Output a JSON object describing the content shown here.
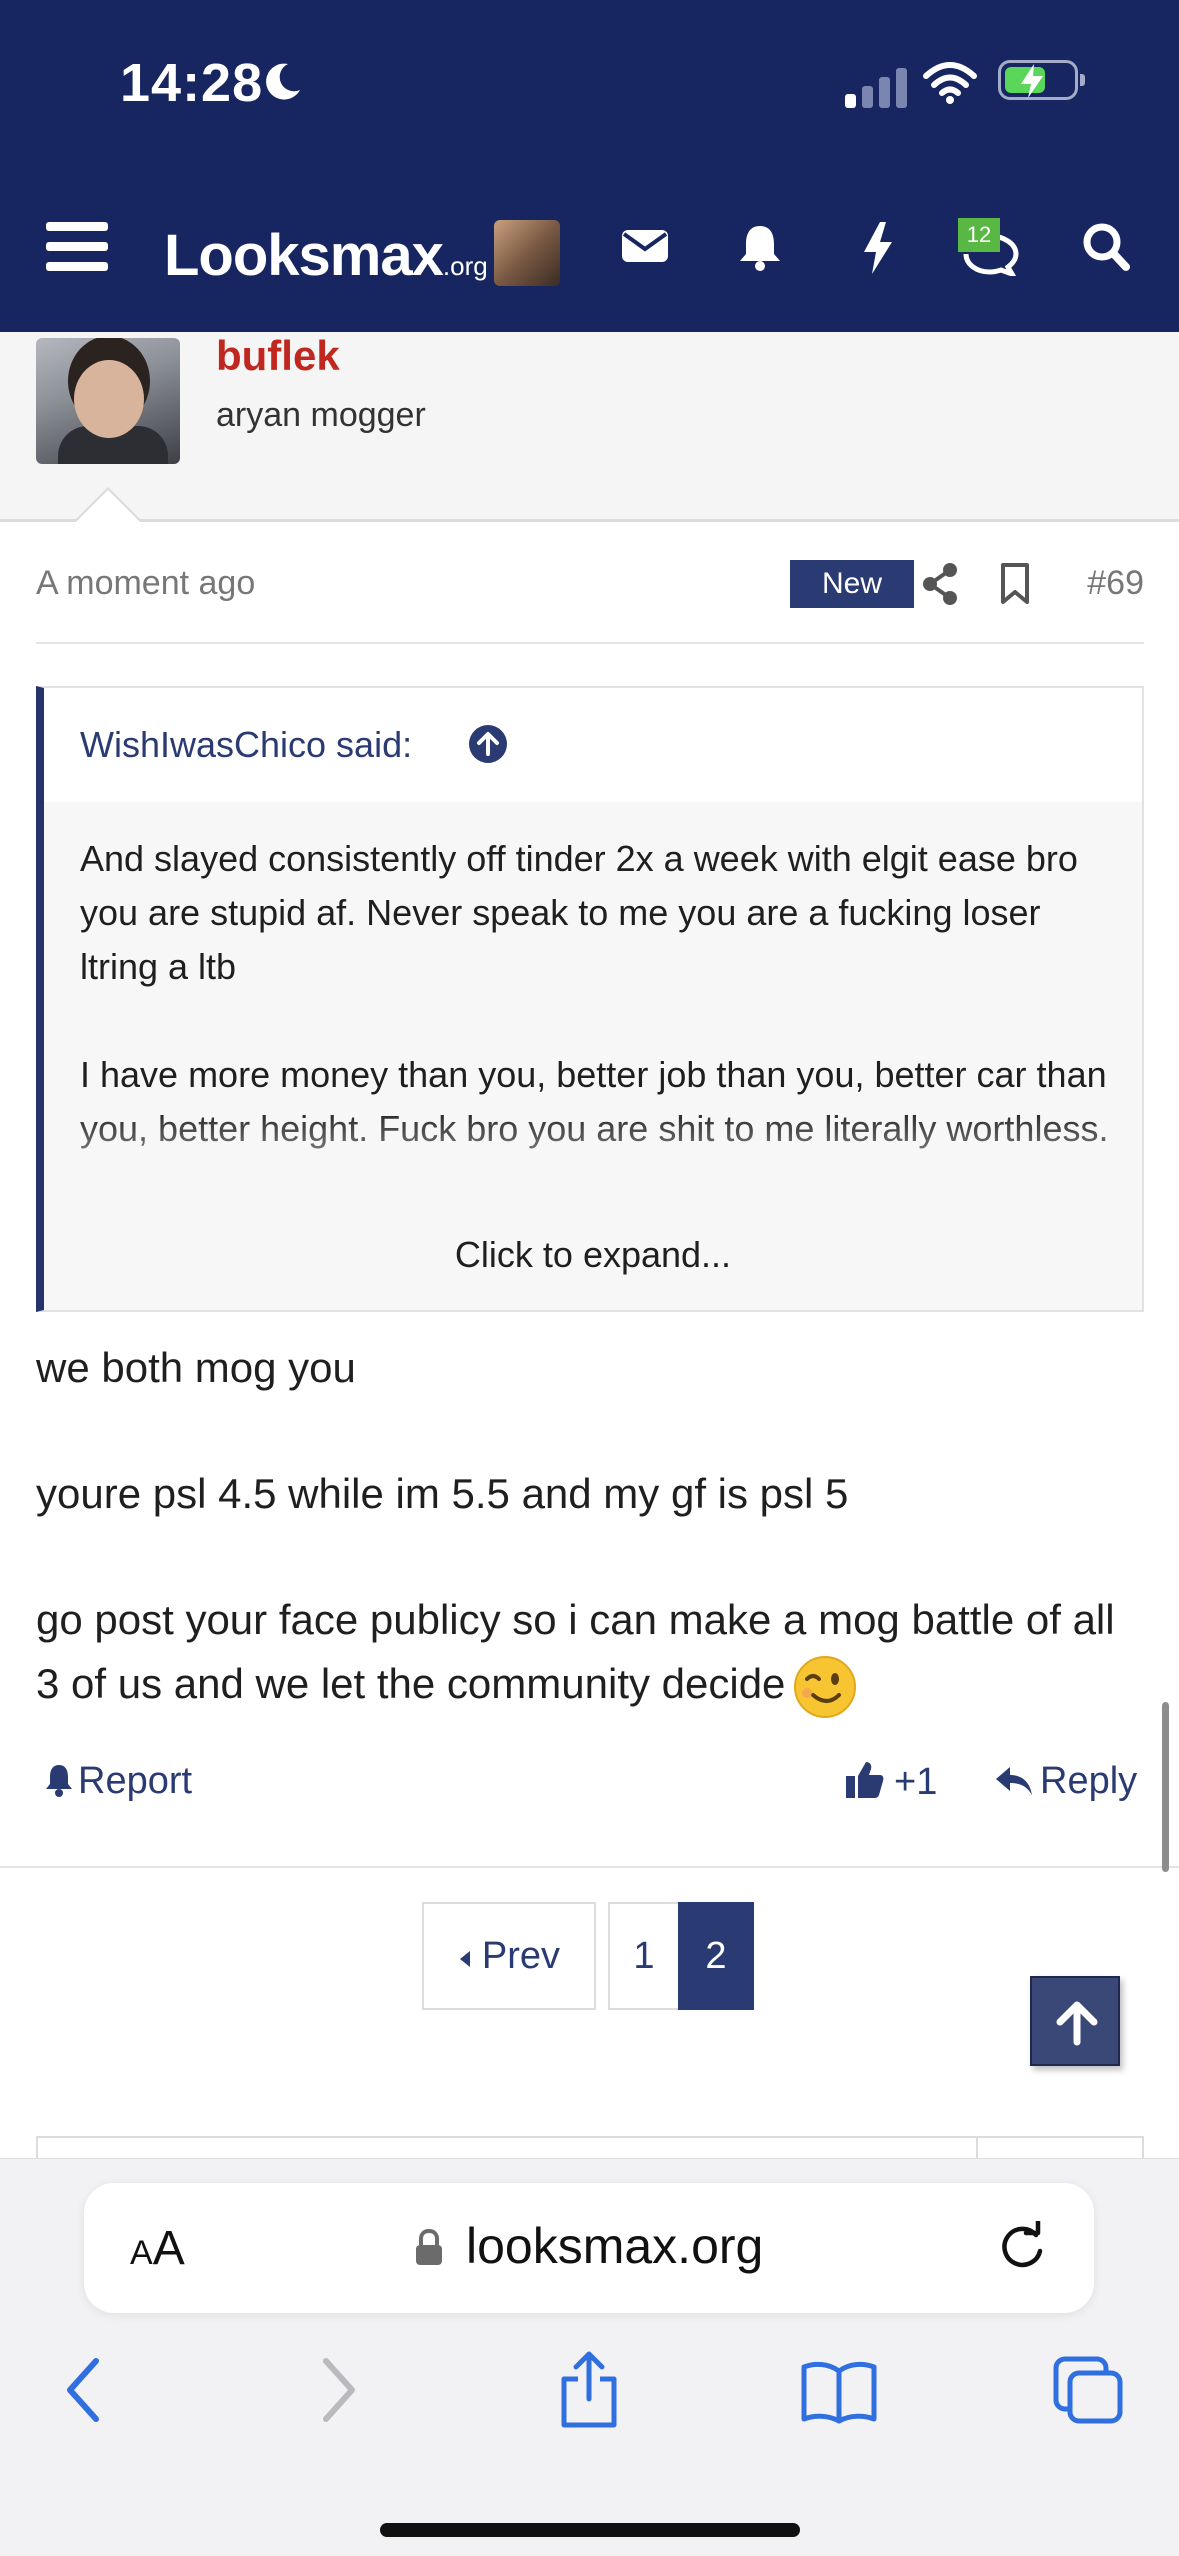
{
  "status_bar": {
    "time": "14:28"
  },
  "header": {
    "logo_main": "Looksmax",
    "logo_suffix": ".org",
    "conversations_badge": "12"
  },
  "post": {
    "username": "buflek",
    "user_title": "aryan mogger",
    "timestamp": "A moment ago",
    "new_badge": "New",
    "post_number": "#69",
    "quote": {
      "author": "WishIwasChico said:",
      "paragraphs": [
        "And slayed consistently off tinder 2x a week with elgit ease bro you are stupid af. Never speak to me you are a fucking loser ltring a ltb",
        "I have more money than you, better job than you, better car than you, better height. Fuck bro you are shit to me literally worthless."
      ],
      "expand": "Click to expand..."
    },
    "body": [
      "we both mog you",
      "youre psl 4.5 while im 5.5 and my gf is psl 5",
      "go post your face publicy so i can make a mog battle of all 3 of us and we let the community decide"
    ],
    "actions": {
      "report": "Report",
      "like_count": "+1",
      "reply": "Reply"
    }
  },
  "pagination": {
    "prev": "Prev",
    "pages": [
      "1",
      "2"
    ],
    "current": "2"
  },
  "browser": {
    "text_size_label_small": "A",
    "text_size_label_large": "A",
    "url": "looksmax.org"
  },
  "colors": {
    "header_bg": "#172660",
    "accent": "#2a3a72",
    "username": "#c0271f",
    "badge_green": "#59b744"
  }
}
